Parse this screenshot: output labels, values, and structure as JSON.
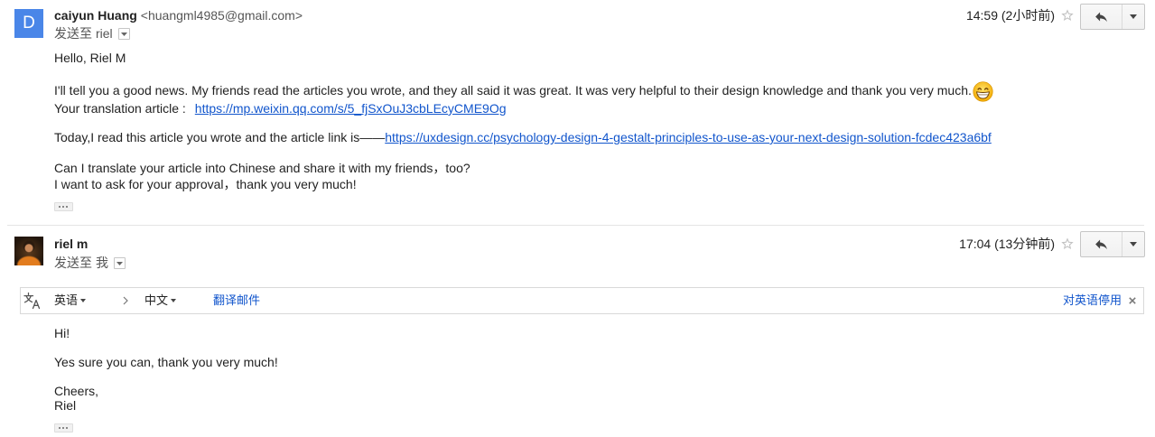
{
  "colors": {
    "text": "#222222",
    "link": "#1155cc",
    "muted": "#555555",
    "divider": "#e5e5e5"
  },
  "messages": [
    {
      "avatar_letter": "D",
      "avatar_color": "#4a86e8",
      "sender_name": "caiyun Huang",
      "sender_email": "<huangml4985@gmail.com>",
      "recipients_label": "发送至",
      "recipients": "riel",
      "time": "14:59 (2小时前)",
      "star_icon": "star-outline-icon",
      "reply_icon": "reply-icon",
      "more_icon": "chevron-down-icon",
      "body": {
        "greeting": "Hello, Riel M",
        "paragraph1": "I'll tell you a good news. My friends read the articles you wrote, and they all said it was great. It was very helpful to their design knowledge and thank you very much.",
        "paragraph1_emoji": "grinning-face-icon",
        "translation_label": "Your translation article :",
        "translation_link": "https://mp.weixin.qq.com/s/5_fjSxOuJ3cbLEcyCME9Og",
        "article_text": "Today,I read this article you wrote and the article link is——",
        "article_link": "https://uxdesign.cc/psychology-design-4-gestalt-principles-to-use-as-your-next-design-solution-fcdec423a6bf",
        "request_line1": "Can I translate your article into Chinese and share it with my friends，too?",
        "request_line2": "I want to ask for your approval，thank you very much!"
      },
      "trimmed_content_icon": "ellipsis-icon"
    },
    {
      "avatar_icon": "profile-photo",
      "sender_name": "riel m",
      "recipients_label": "发送至",
      "recipients": "我",
      "time": "17:04 (13分钟前)",
      "star_icon": "star-outline-icon",
      "reply_icon": "reply-icon",
      "more_icon": "chevron-down-icon",
      "translate_bar": {
        "icon": "translate-icon",
        "source_language": "英语",
        "target_language": "中文",
        "translate_link": "翻译邮件",
        "disable_link": "对英语停用",
        "close_icon": "close-icon"
      },
      "body": {
        "lines": [
          "Hi!",
          "Yes sure you can, thank you very much!",
          "Cheers,",
          "Riel"
        ]
      },
      "trimmed_content_icon": "ellipsis-icon"
    }
  ]
}
